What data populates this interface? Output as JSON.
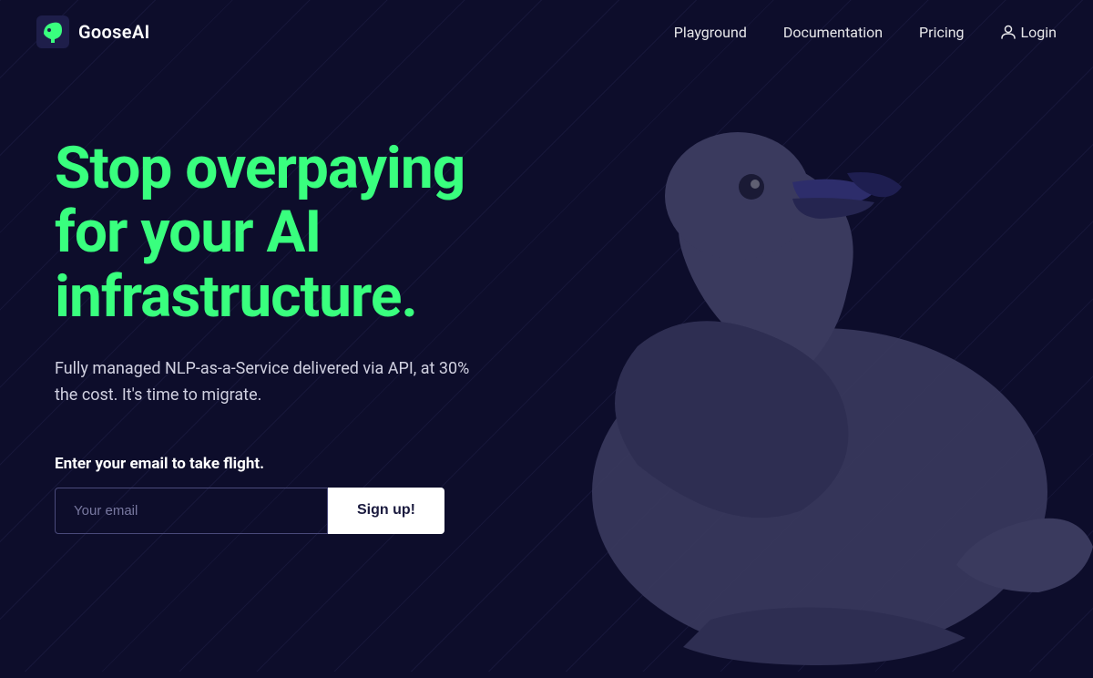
{
  "brand": {
    "name": "GooseAI",
    "logo_alt": "GooseAI logo"
  },
  "nav": {
    "links": [
      {
        "label": "Playground",
        "href": "#"
      },
      {
        "label": "Documentation",
        "href": "#"
      },
      {
        "label": "Pricing",
        "href": "#"
      }
    ],
    "login_label": "Login"
  },
  "hero": {
    "title": "Stop overpaying for your AI infrastructure.",
    "subtitle": "Fully managed NLP-as-a-Service delivered via API, at 30% the cost. It's time to migrate.",
    "email_cta": "Enter your email to take flight.",
    "email_placeholder": "Your email",
    "signup_button": "Sign up!"
  },
  "colors": {
    "background": "#0d0d2b",
    "accent_green": "#39ff7e",
    "text_white": "#ffffff",
    "text_muted": "#d0d0e0",
    "goose_body": "#3a3a5c",
    "goose_beak": "#2d2d6b"
  }
}
